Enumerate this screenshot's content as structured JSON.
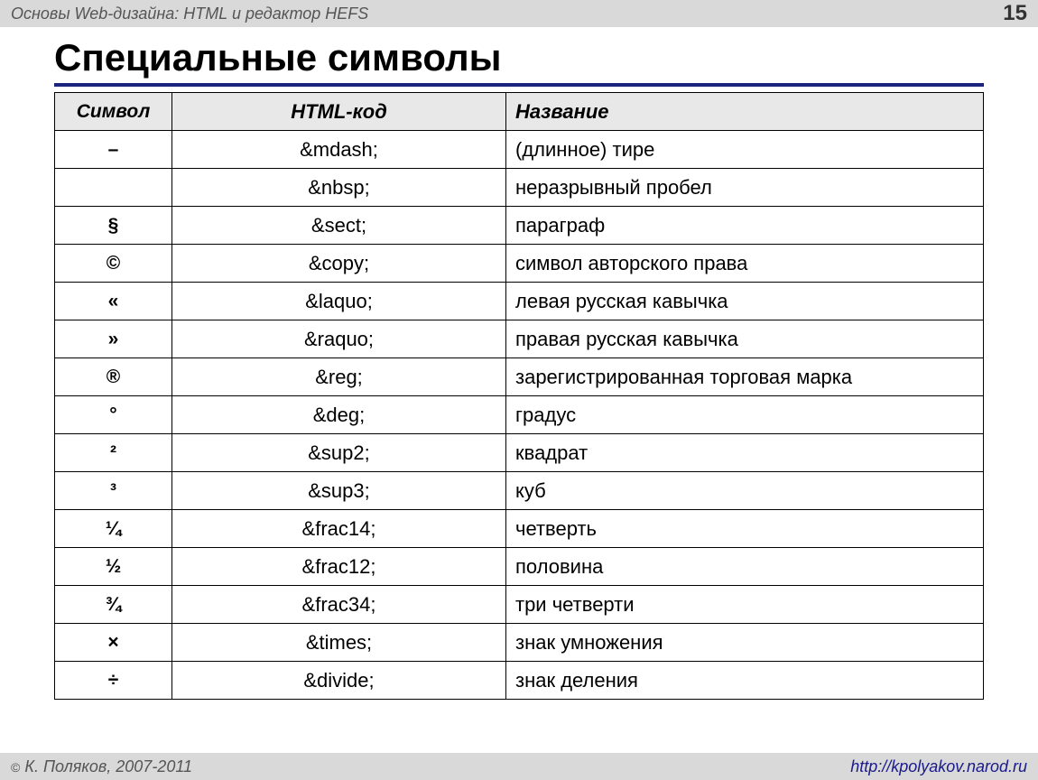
{
  "header": {
    "title": "Основы Web-дизайна: HTML и редактор HEFS",
    "page": "15"
  },
  "title": "Специальные символы",
  "table": {
    "headers": {
      "symbol": "Символ",
      "code": "HTML-код",
      "name": "Название"
    },
    "rows": [
      {
        "symbol": "–",
        "code": "&mdash;",
        "name": "(длинное) тире"
      },
      {
        "symbol": "",
        "code": "&nbsp;",
        "name": "неразрывный пробел"
      },
      {
        "symbol": "§",
        "code": "&sect;",
        "name": "параграф"
      },
      {
        "symbol": "©",
        "code": "&copy;",
        "name": "символ авторского права"
      },
      {
        "symbol": "«",
        "code": "&laquo;",
        "name": "левая русская кавычка"
      },
      {
        "symbol": "»",
        "code": "&raquo;",
        "name": "правая русская кавычка"
      },
      {
        "symbol": "®",
        "code": "&reg;",
        "name": "зарегистрированная торговая марка"
      },
      {
        "symbol": "°",
        "code": "&deg;",
        "name": "градус"
      },
      {
        "symbol": "²",
        "code": "&sup2;",
        "name": "квадрат"
      },
      {
        "symbol": "³",
        "code": "&sup3;",
        "name": "куб"
      },
      {
        "symbol": "¼",
        "code": "&frac14;",
        "name": "четверть"
      },
      {
        "symbol": "½",
        "code": "&frac12;",
        "name": "половина"
      },
      {
        "symbol": "¾",
        "code": "&frac34;",
        "name": "три четверти"
      },
      {
        "symbol": "×",
        "code": "&times;",
        "name": "знак умножения"
      },
      {
        "symbol": "÷",
        "code": "&divide;",
        "name": "знак деления"
      }
    ]
  },
  "footer": {
    "left_prefix": " К. Поляков, 2007-2011",
    "copy": "©",
    "right": "http://kpolyakov.narod.ru"
  }
}
